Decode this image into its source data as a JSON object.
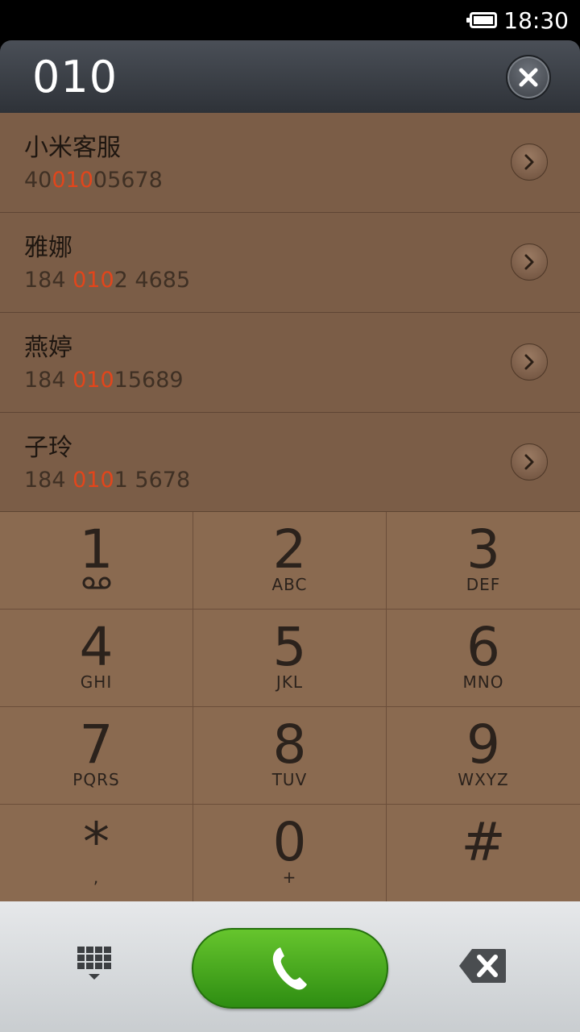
{
  "status_bar": {
    "time": "18:30",
    "battery_level": 1.0,
    "battery_icon": "battery-icon"
  },
  "dialer": {
    "input_value": "010",
    "clear_icon": "close-icon"
  },
  "results": [
    {
      "name": "小米客服",
      "number_parts": [
        "40",
        "010",
        "05678"
      ]
    },
    {
      "name": "雅娜",
      "number_parts": [
        "184 ",
        "010",
        "2 4685"
      ]
    },
    {
      "name": "燕婷",
      "number_parts": [
        "184 ",
        "010",
        "15689"
      ]
    },
    {
      "name": "子玲",
      "number_parts": [
        "184 ",
        "010",
        "1 5678"
      ]
    }
  ],
  "keypad": [
    {
      "digit": "1",
      "letters": ""
    },
    {
      "digit": "2",
      "letters": "ABC"
    },
    {
      "digit": "3",
      "letters": "DEF"
    },
    {
      "digit": "4",
      "letters": "GHI"
    },
    {
      "digit": "5",
      "letters": "JKL"
    },
    {
      "digit": "6",
      "letters": "MNO"
    },
    {
      "digit": "7",
      "letters": "PQRS"
    },
    {
      "digit": "8",
      "letters": "TUV"
    },
    {
      "digit": "9",
      "letters": "WXYZ"
    },
    {
      "digit": "*",
      "letters": ","
    },
    {
      "digit": "0",
      "letters": "+"
    },
    {
      "digit": "#",
      "letters": ""
    }
  ],
  "icons": {
    "voicemail": "voicemail-icon",
    "dialpad": "dialpad-icon",
    "call": "phone-icon",
    "backspace": "backspace-icon",
    "chevron": "chevron-right-icon"
  },
  "colors": {
    "highlight": "#e2451b",
    "call_green": "#4caf1f",
    "list_bg": "#7b5d47",
    "keypad_bg": "#8a6a50"
  }
}
